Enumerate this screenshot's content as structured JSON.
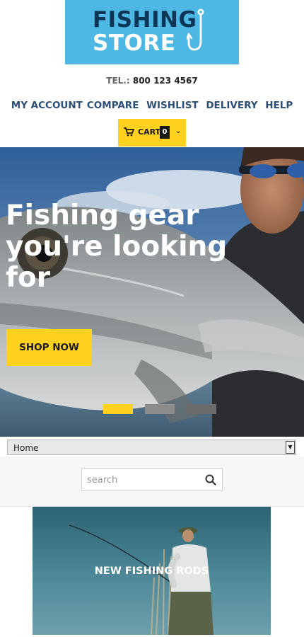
{
  "logo": {
    "line1": "FISHING",
    "line2": "STORE"
  },
  "contact": {
    "label": "TEL.:",
    "phone": "800 123 4567"
  },
  "nav": {
    "items": [
      "MY ACCOUNT",
      "COMPARE",
      "WISHLIST",
      "DELIVERY",
      "HELP"
    ]
  },
  "cart": {
    "label": "CART",
    "count": "0"
  },
  "hero": {
    "title": "Fishing gear you're looking for",
    "button": "SHOP NOW",
    "slides_total": 3,
    "active_slide": 1
  },
  "category_select": {
    "value": "Home"
  },
  "search": {
    "placeholder": "search"
  },
  "promo": {
    "title": "NEW FISHING RODS"
  },
  "colors": {
    "logo_bg": "#4db8e4",
    "accent": "#ffd11f",
    "nav_text": "#2b4f76",
    "dark": "#0d3656"
  }
}
